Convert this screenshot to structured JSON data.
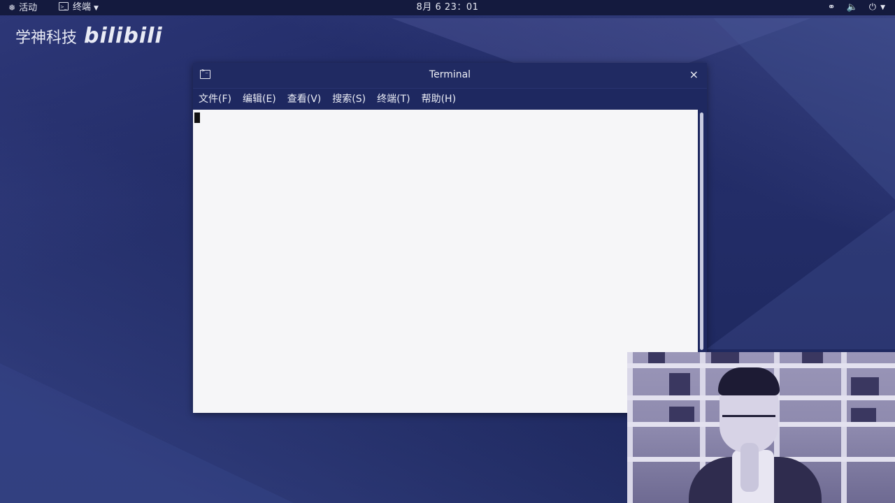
{
  "topbar": {
    "activities": "活动",
    "app_menu": "终端",
    "clock": "8月 6  23：01",
    "icons": [
      "network-icon",
      "volume-icon",
      "power-icon"
    ]
  },
  "watermark": {
    "text": "学神科技",
    "logo": "bilibili"
  },
  "window": {
    "title": "Terminal",
    "close": "×",
    "menu": [
      "文件(F)",
      "编辑(E)",
      "查看(V)",
      "搜索(S)",
      "终端(T)",
      "帮助(H)"
    ]
  },
  "colors": {
    "desktop_bg": "#1f2a63",
    "topbar_bg": "#141a3e",
    "terminal_bg": "#f6f6f8"
  }
}
